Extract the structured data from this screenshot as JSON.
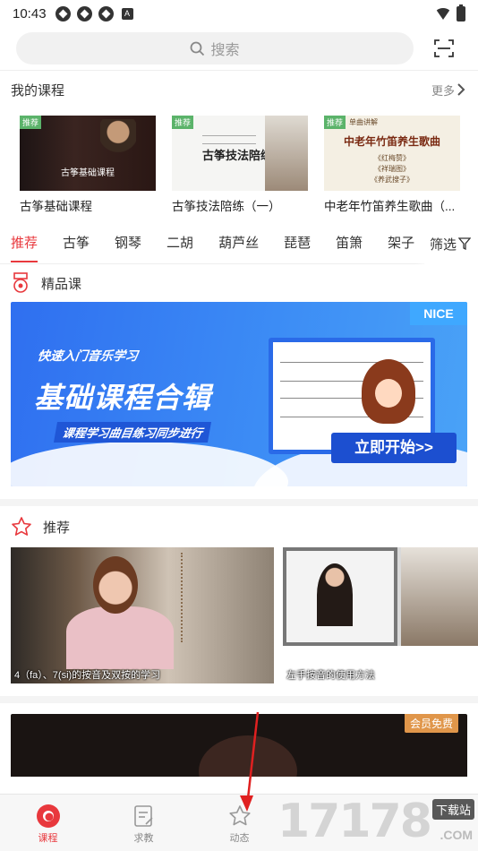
{
  "status": {
    "time": "10:43",
    "badge": "A"
  },
  "search": {
    "placeholder": "搜索"
  },
  "my_courses": {
    "title": "我的课程",
    "more": "更多",
    "items": [
      {
        "tag": "推荐",
        "thumb_caption": "古筝基础课程",
        "name": "古筝基础课程"
      },
      {
        "tag": "推荐",
        "thumb_caption": "古筝技法陪练",
        "name": "古筝技法陪练（一）"
      },
      {
        "tag": "推荐",
        "thumb_caption": "中老年竹笛养生歌曲",
        "thumb_sub": [
          "《红梅赞》",
          "《祥瑞图》",
          "《养武搜子》"
        ],
        "thumb_top": "单曲讲解",
        "name": "中老年竹笛养生歌曲（..."
      }
    ]
  },
  "tabs": {
    "items": [
      "推荐",
      "古筝",
      "钢琴",
      "二胡",
      "葫芦丝",
      "琵琶",
      "笛箫",
      "架子"
    ],
    "active_index": 0,
    "filter": "筛选"
  },
  "premium": {
    "title": "精品课",
    "banner": {
      "line1": "快速入门音乐学习",
      "line2": "基础课程合辑",
      "line3": "课程学习曲目练习同步进行",
      "badge": "NICE",
      "cta": "立即开始>>"
    }
  },
  "recommend": {
    "title": "推荐",
    "videos": [
      {
        "caption": "4（fa）、7(si)的按音及双按的学习"
      },
      {
        "caption": "左手按音的使用方法"
      }
    ],
    "card_badge": "会员免费"
  },
  "bottom_nav": [
    {
      "label": "课程",
      "active": true
    },
    {
      "label": "求教",
      "active": false
    },
    {
      "label": "动态",
      "active": false
    }
  ],
  "watermark": {
    "number": "17178",
    "tag": "下载站",
    "suffix": ".COM"
  },
  "colors": {
    "accent": "#e8383d",
    "banner_blue": "#3c8cf5",
    "tag_green": "#5bb36a"
  }
}
